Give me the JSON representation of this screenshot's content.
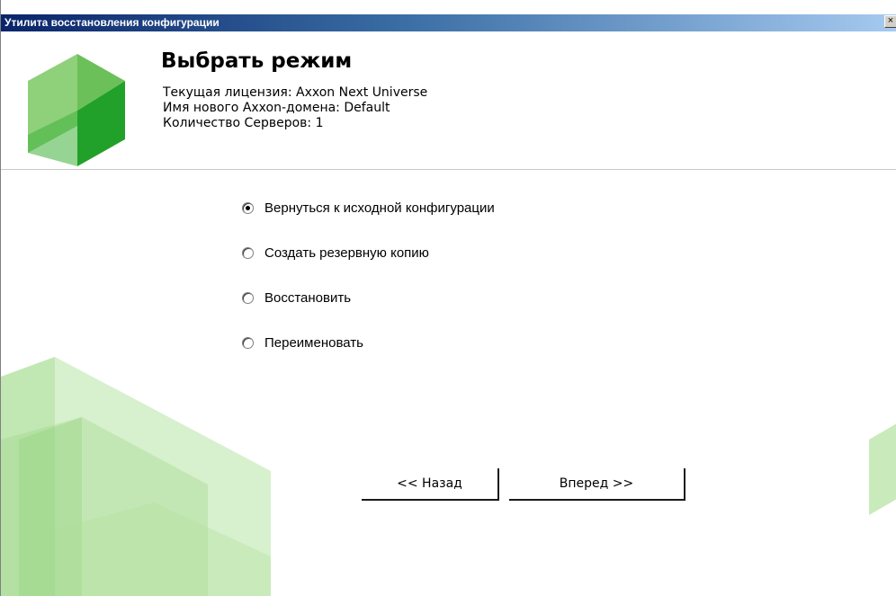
{
  "window": {
    "title": "Утилита восстановления конфигурации",
    "close_label": "×"
  },
  "header": {
    "title": "Выбрать режим",
    "license_line": "Текущая лицензия: Axxon Next Universe",
    "domain_line": "Имя нового Axxon-домена: Default",
    "servers_line": "Количество Серверов: 1"
  },
  "modes": {
    "selected_index": 0,
    "items": [
      {
        "label": "Вернуться к исходной конфигурации",
        "checked": true
      },
      {
        "label": "Создать резервную копию",
        "checked": false
      },
      {
        "label": "Восстановить",
        "checked": false
      },
      {
        "label": "Переименовать",
        "checked": false
      }
    ]
  },
  "buttons": {
    "back_label": "<< Назад",
    "next_label": "Вперед >>"
  },
  "colors": {
    "titlebar_start": "#0a246a",
    "titlebar_end": "#a6caf0",
    "logo_dark": "#22a12a",
    "logo_light": "#8fd07a",
    "decor_green": "#b7e3a4"
  },
  "icons": {
    "logo": "axxon-logo-icon",
    "close": "close-icon"
  }
}
